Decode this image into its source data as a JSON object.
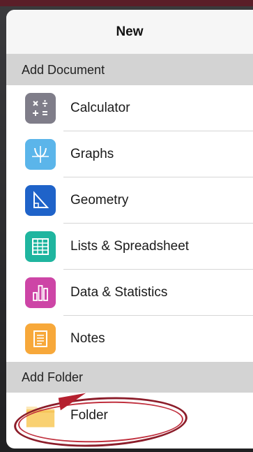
{
  "popover": {
    "title": "New",
    "add_document_label": "Add Document",
    "add_folder_label": "Add Folder"
  },
  "documents": [
    {
      "label": "Calculator",
      "icon": "calculator-icon",
      "color": "#7f7d89"
    },
    {
      "label": "Graphs",
      "icon": "graphs-icon",
      "color": "#5bb5ea"
    },
    {
      "label": "Geometry",
      "icon": "geometry-icon",
      "color": "#1f63c9"
    },
    {
      "label": "Lists & Spreadsheet",
      "icon": "spreadsheet-icon",
      "color": "#1fb59f"
    },
    {
      "label": "Data & Statistics",
      "icon": "data-statistics-icon",
      "color": "#cd45a6"
    },
    {
      "label": "Notes",
      "icon": "notes-icon",
      "color": "#f7a83a"
    }
  ],
  "folder": {
    "label": "Folder",
    "icon": "folder-icon",
    "color": "#f9d172"
  }
}
